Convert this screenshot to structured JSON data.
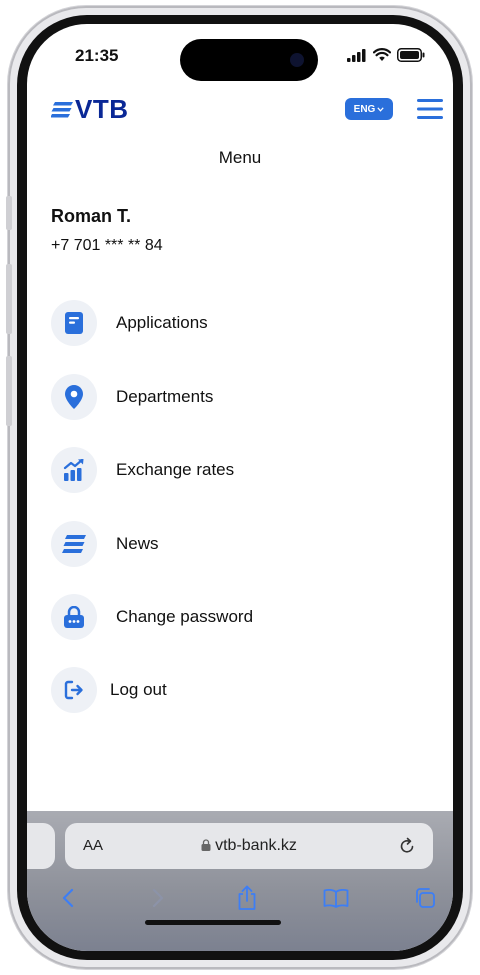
{
  "status_bar": {
    "time": "21:35"
  },
  "header": {
    "logo_text": "VTB",
    "language": "ENG",
    "brand_color": "#0a2896",
    "accent_color": "#2a6fdb"
  },
  "menu": {
    "title": "Menu",
    "user": {
      "name": "Roman T.",
      "phone": "+7 701 *** ** 84"
    },
    "items": [
      {
        "label": "Applications",
        "icon": "document-icon"
      },
      {
        "label": "Departments",
        "icon": "location-pin-icon"
      },
      {
        "label": "Exchange rates",
        "icon": "chart-icon"
      },
      {
        "label": "News",
        "icon": "news-icon"
      },
      {
        "label": "Change password",
        "icon": "lock-icon"
      },
      {
        "label": "Log out",
        "icon": "logout-icon"
      }
    ]
  },
  "browser": {
    "text_size_label": "AA",
    "url": "vtb-bank.kz"
  }
}
